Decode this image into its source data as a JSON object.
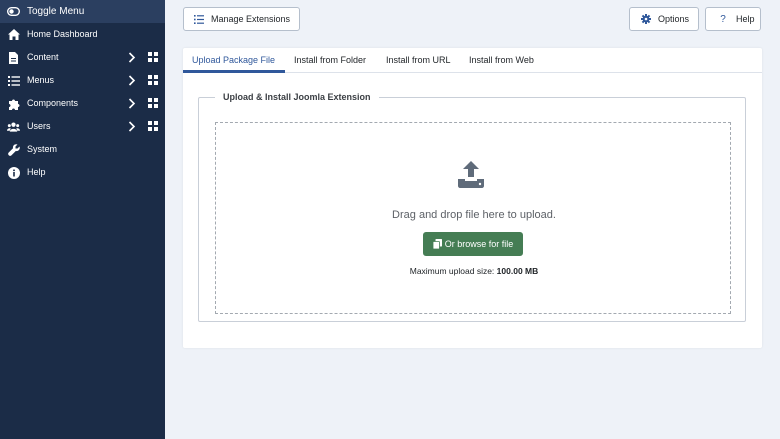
{
  "sidebar": {
    "toggle": "Toggle Menu",
    "items": [
      {
        "label": "Home Dashboard",
        "icon": "home-icon",
        "expandable": false
      },
      {
        "label": "Content",
        "icon": "file-icon",
        "expandable": true
      },
      {
        "label": "Menus",
        "icon": "list-icon",
        "expandable": true
      },
      {
        "label": "Components",
        "icon": "puzzle-icon",
        "expandable": true
      },
      {
        "label": "Users",
        "icon": "users-icon",
        "expandable": true
      },
      {
        "label": "System",
        "icon": "wrench-icon",
        "expandable": false
      },
      {
        "label": "Help",
        "icon": "info-icon",
        "expandable": false
      }
    ]
  },
  "toolbar": {
    "manage_label": "Manage Extensions",
    "options_label": "Options",
    "help_label": "Help"
  },
  "tabs": [
    {
      "label": "Upload Package File",
      "active": true
    },
    {
      "label": "Install from Folder",
      "active": false
    },
    {
      "label": "Install from URL",
      "active": false
    },
    {
      "label": "Install from Web",
      "active": false
    }
  ],
  "upload": {
    "legend": "Upload & Install Joomla Extension",
    "drag_text": "Drag and drop file here to upload.",
    "browse_label": "Or browse for file",
    "max_label": "Maximum upload size:",
    "max_value": "100.00 MB"
  },
  "colors": {
    "sidebar_bg": "#1b2c47",
    "accent": "#30589b",
    "browse_button": "#457d54",
    "page_bg": "#eef2f8"
  }
}
